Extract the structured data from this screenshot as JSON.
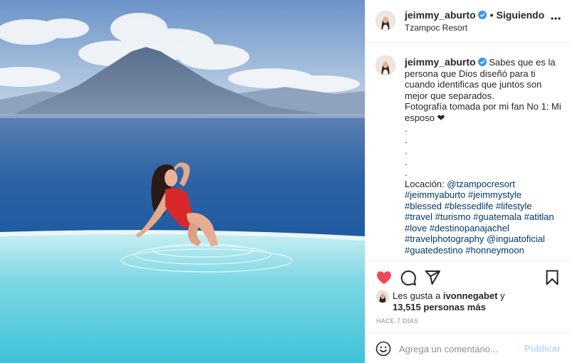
{
  "header": {
    "username": "jeimmy_aburto",
    "separator": "•",
    "follow_status": "Siguiendo",
    "location": "Tzampoc Resort"
  },
  "caption": {
    "username": "jeimmy_aburto",
    "lines": [
      "Sabes que es la persona que Dios diseñó para ti cuando identificas que juntos son mejor que separados.",
      "Fotografía tomada por mi fan No 1: Mi esposo ❤",
      ".",
      ".",
      ".",
      ".",
      ".",
      "Locación: ",
      "@tzampocresort"
    ],
    "hashtag_lines": [
      "#jeimmyaburto #jeimmystyle",
      "#blessed #blessedlife #lifestyle",
      "#travel #turismo #guatemala #atitlan",
      "#love #destinopanajachel",
      "#travelphotography @inguatoficial",
      "#guatedestino #honneymoon"
    ]
  },
  "icons": {
    "like": "heart-icon",
    "like_color": "#ed4956",
    "comment": "comment-bubble-icon",
    "share": "paper-plane-icon",
    "save": "bookmark-icon",
    "more": "more-options-icon",
    "verified": "verified-badge-icon",
    "verified_color": "#3897f0",
    "emoji": "emoji-icon"
  },
  "likes": {
    "prefix": "Les gusta a ",
    "liker": "ivonnegabet",
    "conj": " y",
    "count_text": "13,515 personas más"
  },
  "timestamp": "HACE 7 DÍAS",
  "comment_box": {
    "placeholder": "Agrega un comentario...",
    "publish_label": "Publicar",
    "publish_color": "#b3dbff"
  }
}
